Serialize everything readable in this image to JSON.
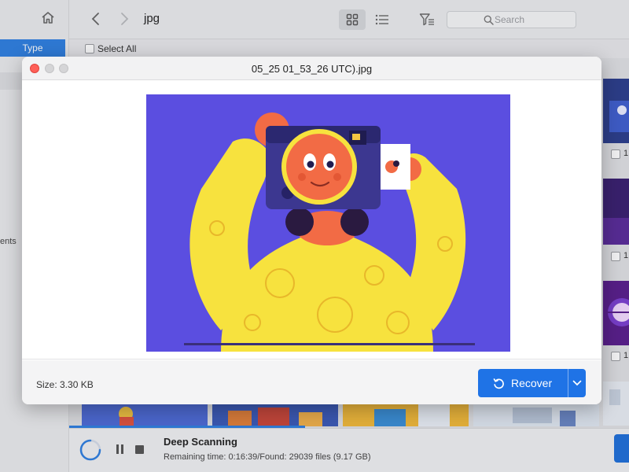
{
  "sidebar": {
    "type_tab": "Type",
    "fragment_label": "ents"
  },
  "toolbar": {
    "folder_title": "jpg",
    "search_placeholder": "Search"
  },
  "select_all_label": "Select All",
  "right_column_items": [
    "1",
    "1",
    "1"
  ],
  "status": {
    "title": "Deep Scanning",
    "remaining": "Remaining time: 0:16:39/Found: 29039 files (9.17 GB)"
  },
  "dialog": {
    "title": "05_25 01_53_26 UTC).jpg",
    "size_label": "Size: 3.30 KB",
    "recover_label": "Recover"
  },
  "colors": {
    "accent": "#1f73e6",
    "preview_background": "#5b4ee0",
    "close_button": "#fe5f57"
  }
}
